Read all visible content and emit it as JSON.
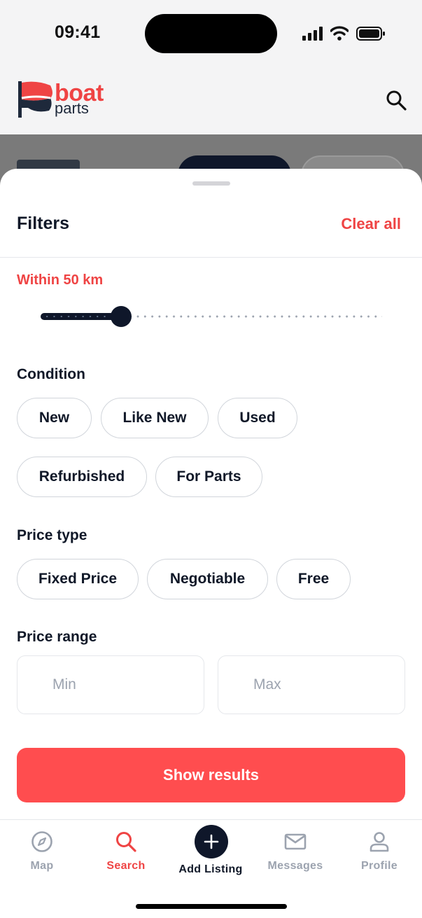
{
  "status_bar": {
    "time": "09:41"
  },
  "header": {
    "logo_word": "boat",
    "logo_sub": "parts",
    "search_icon": "search-icon"
  },
  "filters": {
    "title": "Filters",
    "clear_all": "Clear all",
    "distance": {
      "label": "Within 50 km",
      "value_fraction": 0.235
    },
    "condition": {
      "label": "Condition",
      "options": [
        "New",
        "Like New",
        "Used",
        "Refurbished",
        "For Parts"
      ]
    },
    "price_type": {
      "label": "Price type",
      "options": [
        "Fixed Price",
        "Negotiable",
        "Free"
      ]
    },
    "price_range": {
      "label": "Price range",
      "min_placeholder": "Min",
      "max_placeholder": "Max"
    },
    "show_results": "Show results"
  },
  "tabbar": {
    "items": [
      {
        "label": "Map",
        "icon": "compass-icon"
      },
      {
        "label": "Search",
        "icon": "search-icon"
      },
      {
        "label": "Add Listing",
        "icon": "plus-icon"
      },
      {
        "label": "Messages",
        "icon": "mail-icon"
      },
      {
        "label": "Profile",
        "icon": "user-icon"
      }
    ],
    "active": "Search"
  },
  "colors": {
    "accent": "#ef4444",
    "button": "#ff4d4f",
    "dark": "#0f172a"
  }
}
